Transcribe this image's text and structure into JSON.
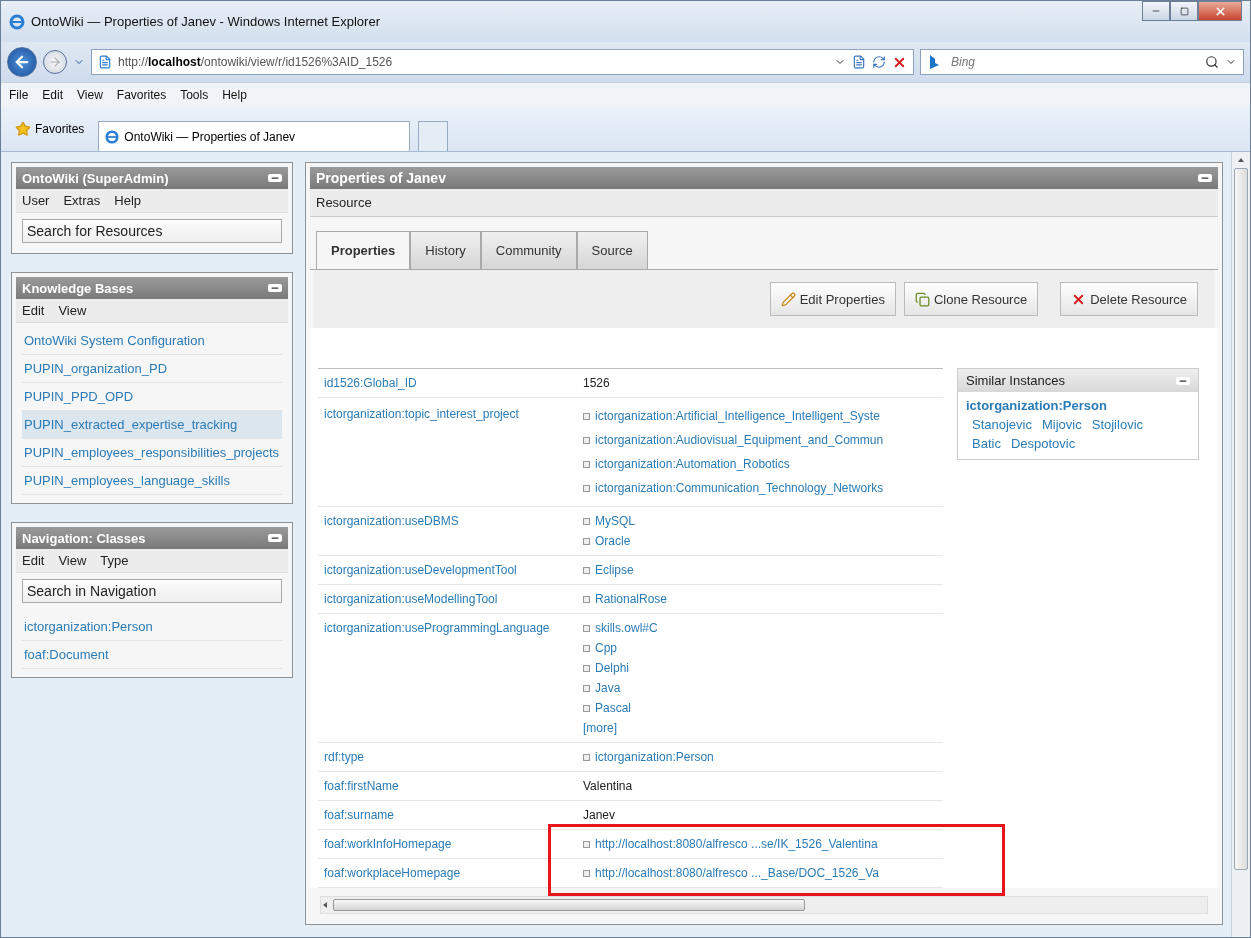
{
  "window": {
    "title": "OntoWiki — Properties of Janev - Windows Internet Explorer"
  },
  "address_bar": {
    "url": "http://**localhost**/ontowiki/view/r/id1526%3AID_1526"
  },
  "search": {
    "placeholder": "Bing"
  },
  "menu": [
    "File",
    "Edit",
    "View",
    "Favorites",
    "Tools",
    "Help"
  ],
  "favorites": {
    "label": "Favorites"
  },
  "browser_tabs": [
    {
      "label": "OntoWiki — Properties of Janev",
      "selected": true
    }
  ],
  "sidebar": [
    {
      "title": "OntoWiki (SuperAdmin)",
      "menu": [
        "User",
        "Extras",
        "Help"
      ],
      "search": {
        "placeholder": "Search for Resources"
      }
    },
    {
      "title": "Knowledge Bases",
      "menu": [
        "Edit",
        "View"
      ],
      "items": [
        {
          "label": "OntoWiki System Configuration",
          "selected": false
        },
        {
          "label": "PUPIN_organization_PD",
          "selected": false
        },
        {
          "label": "PUPIN_PPD_OPD",
          "selected": false
        },
        {
          "label": "PUPIN_extracted_expertise_tracking",
          "selected": true
        },
        {
          "label": "PUPIN_employees_responsibilities_projects",
          "selected": false
        },
        {
          "label": "PUPIN_employees_language_skills",
          "selected": false
        }
      ]
    },
    {
      "title": "Navigation: Classes",
      "menu": [
        "Edit",
        "View",
        "Type"
      ],
      "search": {
        "placeholder": "Search in Navigation"
      },
      "items": [
        {
          "label": "ictorganization:Person",
          "selected": false
        },
        {
          "label": "foaf:Document",
          "selected": false
        }
      ]
    }
  ],
  "main": {
    "title": "Properties of Janev",
    "subtitle": "Resource",
    "tabs": [
      {
        "label": "Properties",
        "selected": true
      },
      {
        "label": "History",
        "selected": false
      },
      {
        "label": "Community",
        "selected": false
      },
      {
        "label": "Source",
        "selected": false
      }
    ],
    "buttons": [
      {
        "label": "Edit Properties",
        "kind": "edit"
      },
      {
        "label": "Clone Resource",
        "kind": "clone"
      },
      {
        "label": "Delete Resource",
        "kind": "delete"
      }
    ],
    "properties": [
      {
        "label": "id1526:Global_ID",
        "highlighted": false,
        "values": [
          {
            "text": "1526",
            "kind": "literal"
          }
        ]
      },
      {
        "label": "ictorganization:topic_interest_project",
        "highlighted": false,
        "values": [
          {
            "text": "ictorganization:Artificial_Intelligence_Intelligent_Syste",
            "kind": "link"
          },
          {
            "text": "ictorganization:Audiovisual_Equipment_and_Commun",
            "kind": "link"
          },
          {
            "text": "ictorganization:Automation_Robotics",
            "kind": "link"
          },
          {
            "text": "ictorganization:Communication_Technology_Networks",
            "kind": "link"
          }
        ]
      },
      {
        "label": "ictorganization:useDBMS",
        "highlighted": false,
        "values": [
          {
            "text": "MySQL",
            "kind": "link"
          },
          {
            "text": "Oracle",
            "kind": "link"
          }
        ]
      },
      {
        "label": "ictorganization:useDevelopmentTool",
        "highlighted": false,
        "values": [
          {
            "text": "Eclipse",
            "kind": "link"
          }
        ]
      },
      {
        "label": "ictorganization:useModellingTool",
        "highlighted": false,
        "values": [
          {
            "text": "RationalRose",
            "kind": "link"
          }
        ]
      },
      {
        "label": "ictorganization:useProgrammingLanguage",
        "highlighted": false,
        "values": [
          {
            "text": "skills.owl#C",
            "kind": "link"
          },
          {
            "text": "Cpp",
            "kind": "link"
          },
          {
            "text": "Delphi",
            "kind": "link"
          },
          {
            "text": "Java",
            "kind": "link"
          },
          {
            "text": "Pascal",
            "kind": "link"
          }
        ],
        "more": "[more]"
      },
      {
        "label": "rdf:type",
        "highlighted": false,
        "values": [
          {
            "text": "ictorganization:Person",
            "kind": "link"
          }
        ]
      },
      {
        "label": "foaf:firstName",
        "highlighted": false,
        "values": [
          {
            "text": "Valentina",
            "kind": "literal"
          }
        ]
      },
      {
        "label": "foaf:surname",
        "highlighted": false,
        "values": [
          {
            "text": "Janev",
            "kind": "literal"
          }
        ]
      },
      {
        "label": "foaf:workInfoHomepage",
        "highlighted": true,
        "values": [
          {
            "text": "http://localhost:8080/alfresco ...se/IK_1526_Valentina",
            "kind": "link"
          }
        ]
      },
      {
        "label": "foaf:workplaceHomepage",
        "highlighted": true,
        "values": [
          {
            "text": "http://localhost:8080/alfresco ..._Base/DOC_1526_Va",
            "kind": "link"
          }
        ]
      }
    ],
    "similar": {
      "title": "Similar Instances",
      "class": "ictorganization:Person",
      "instances": [
        "Stanojevic",
        "Mijovic",
        "Stojilovic",
        "Batic",
        "Despotovic"
      ]
    }
  }
}
